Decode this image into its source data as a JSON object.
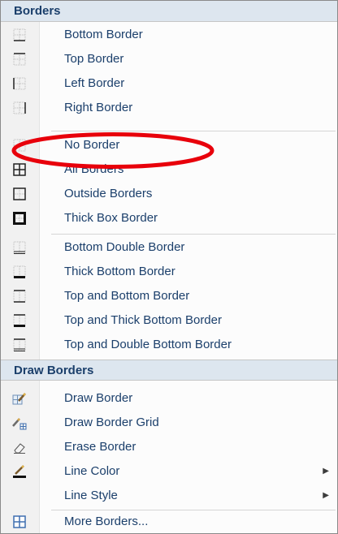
{
  "sections": {
    "borders": "Borders",
    "draw_borders": "Draw Borders"
  },
  "items": {
    "bottom_border": "Bottom Border",
    "top_border": "Top Border",
    "left_border": "Left Border",
    "right_border": "Right Border",
    "no_border": "No Border",
    "all_borders": "All Borders",
    "outside_borders": "Outside Borders",
    "thick_box_border": "Thick Box Border",
    "bottom_double_border": "Bottom Double Border",
    "thick_bottom_border": "Thick Bottom Border",
    "top_and_bottom_border": "Top and Bottom Border",
    "top_and_thick_bottom_border": "Top and Thick Bottom Border",
    "top_and_double_bottom_border": "Top and Double Bottom Border",
    "draw_border": "Draw Border",
    "draw_border_grid": "Draw Border Grid",
    "erase_border": "Erase Border",
    "line_color": "Line Color",
    "line_style": "Line Style",
    "more_borders": "More Borders..."
  },
  "icons": {
    "submenu_arrow": "▶"
  },
  "colors": {
    "label": "#1b3f6b",
    "header_bg": "#dde6ef",
    "annotation_circle": "#e8000b"
  }
}
